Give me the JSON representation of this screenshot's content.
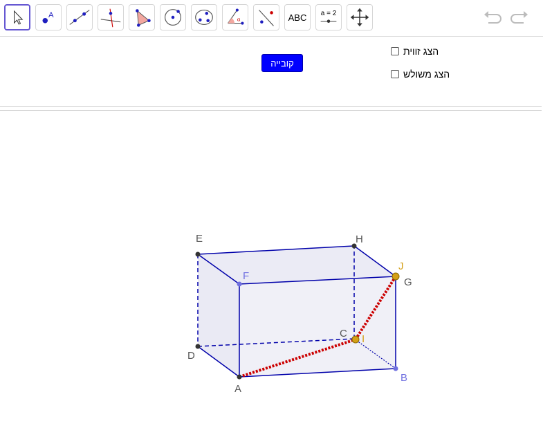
{
  "toolbar": {
    "tools": [
      {
        "name": "move-tool",
        "selected": true
      },
      {
        "name": "point-tool"
      },
      {
        "name": "line-tool"
      },
      {
        "name": "perpendicular-line-tool"
      },
      {
        "name": "polygon-tool"
      },
      {
        "name": "circle-tool"
      },
      {
        "name": "ellipse-tool"
      },
      {
        "name": "angle-tool"
      },
      {
        "name": "reflect-tool"
      },
      {
        "name": "text-tool",
        "label": "ABC"
      },
      {
        "name": "slider-tool",
        "label": "a = 2"
      },
      {
        "name": "move-graphics-view-tool"
      }
    ],
    "undo_icon": "undo-icon",
    "redo_icon": "redo-icon"
  },
  "panel": {
    "cube_button": "קובייה",
    "show_angle": {
      "label": "הצג זווית",
      "checked": false
    },
    "show_triangle": {
      "label": "הצג משולש",
      "checked": false
    }
  },
  "geometry": {
    "labels": {
      "A": "A",
      "B": "B",
      "C": "C",
      "D": "D",
      "E": "E",
      "F": "F",
      "G": "G",
      "H": "H",
      "I": "I",
      "J": "J"
    }
  },
  "colors": {
    "accent": "#6557d2",
    "edge": "#0000aa",
    "highlight_segment": "#cc0000",
    "point_dark": "#333333",
    "point_light": "#7070e0",
    "point_gold": "#d4a017",
    "face_fill": "#ebebf5"
  }
}
